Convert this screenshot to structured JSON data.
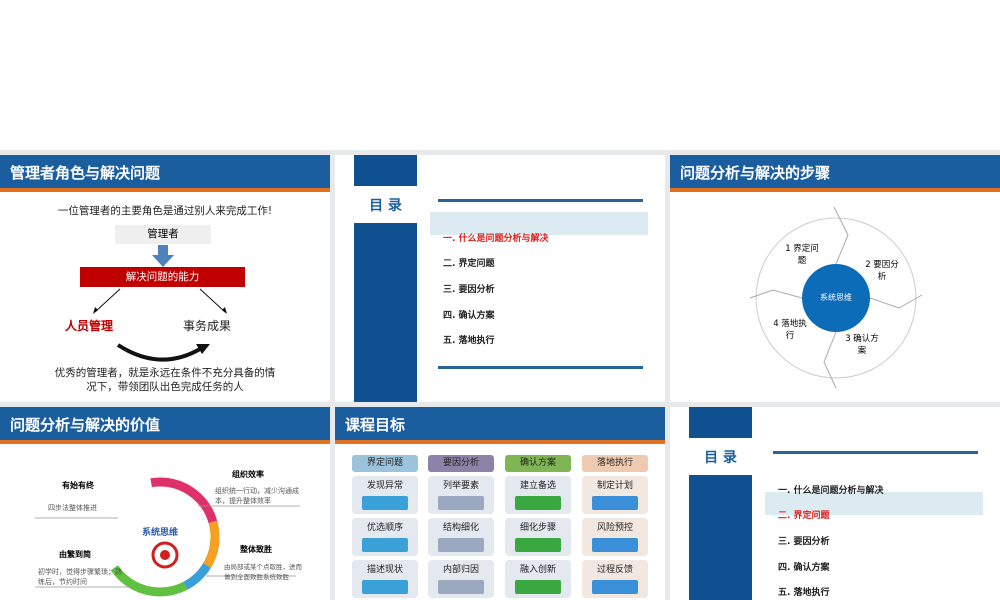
{
  "slide1": {
    "title": "管理者角色与解决问题",
    "intro": "一位管理者的主要角色是通过别人来完成工作!",
    "manager": "管理者",
    "ability": "解决问题的能力",
    "people": "人员管理",
    "results": "事务成果",
    "summary1": "优秀的管理者，就是永远在条件不充分具备的情",
    "summary2": "况下，带领团队出色完成任务的人"
  },
  "slide2": {
    "toc_label": "目 录",
    "items": [
      "一. 什么是问题分析与解决",
      "二. 界定问题",
      "三. 要因分析",
      "四. 确认方案",
      "五. 落地执行"
    ],
    "active": 0
  },
  "slide3": {
    "title": "问题分析与解决的步骤",
    "center": "系统思维",
    "steps": [
      "1 界定问题",
      "2 要因分析",
      "3 确认方案",
      "4 落地执行"
    ]
  },
  "slide4": {
    "title": "问题分析与解决的价值",
    "center": "系统思维",
    "blocks": [
      {
        "title": "有始有终",
        "text": "四步法整体推进"
      },
      {
        "title": "由繁到简",
        "text": "初学时，觉得步骤繁琐；熟练后，节约时间"
      },
      {
        "title": "组织效率",
        "text": "组织统一行动，减少沟通成本，提升整体效率"
      },
      {
        "title": "整体致胜",
        "text": "由局部或某个点取胜，进而做到全面致胜系统致胜"
      }
    ]
  },
  "slide5": {
    "title": "课程目标",
    "columns": [
      {
        "header": "界定问题",
        "color": "#9cc3dc",
        "cells": [
          "发现异常",
          "优选顺序",
          "描述现状"
        ]
      },
      {
        "header": "要因分析",
        "color": "#8d83a8",
        "cells": [
          "列举要素",
          "结构细化",
          "内部归因"
        ]
      },
      {
        "header": "确认方案",
        "color": "#7fb554",
        "cells": [
          "建立备选",
          "细化步骤",
          "融入创新"
        ]
      },
      {
        "header": "落地执行",
        "color": "#eecbb0",
        "cells": [
          "制定计划",
          "风险预控",
          "过程反馈"
        ]
      }
    ]
  },
  "slide6": {
    "toc_label": "目 录",
    "items": [
      "一. 什么是问题分析与解决",
      "二. 界定问题",
      "三. 要因分析",
      "四. 确认方案",
      "五. 落地执行"
    ],
    "active": 1
  },
  "colors": {
    "header_blue": "#1b5e9f",
    "accent_orange": "#e1701f",
    "toc_blue": "#0f5090",
    "red": "#c00000"
  }
}
